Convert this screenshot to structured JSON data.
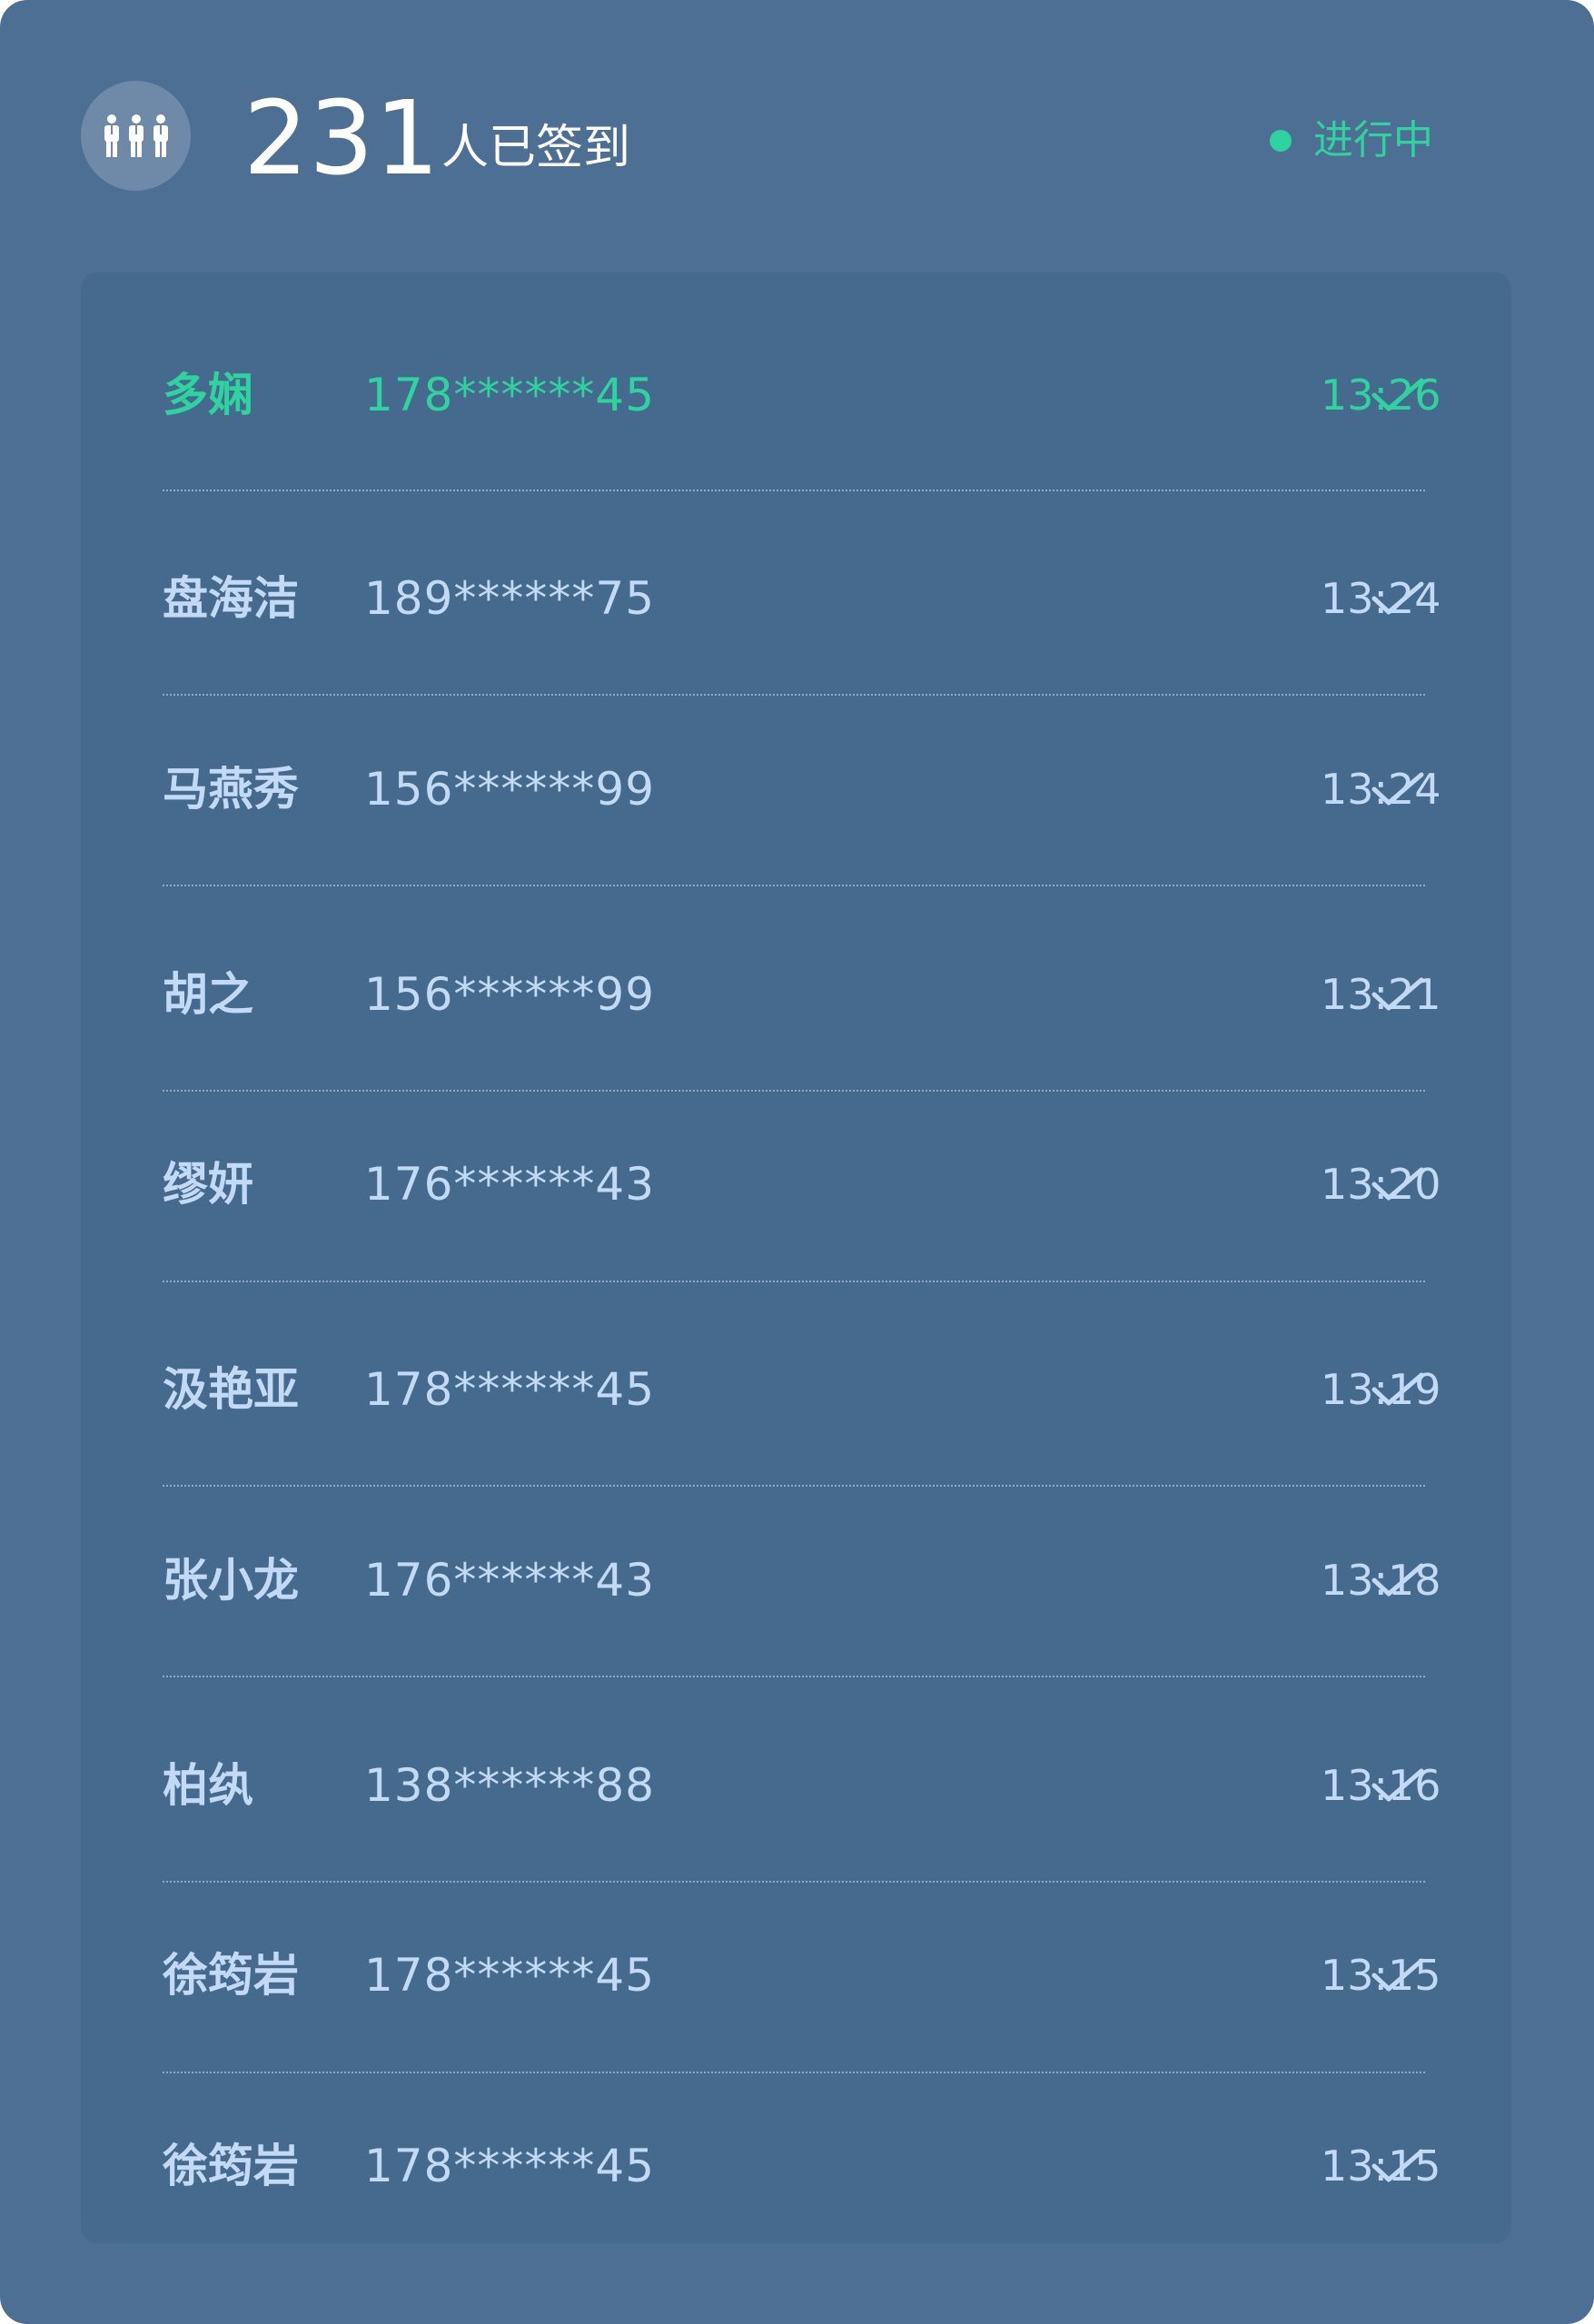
{
  "header": {
    "count": "231",
    "count_label": "人已签到",
    "status": "进行中",
    "icon": "people-group-icon"
  },
  "colors": {
    "panel": "#4e6f94",
    "list": "#466a8d",
    "accent": "#2fd39f",
    "text": "#c2daf5"
  },
  "rows": [
    {
      "name": "多娴",
      "phone": "178******45",
      "time": "13:26",
      "active": true
    },
    {
      "name": "盘海洁",
      "phone": "189******75",
      "time": "13:24",
      "active": false
    },
    {
      "name": "马燕秀",
      "phone": "156******99",
      "time": "13:24",
      "active": false
    },
    {
      "name": "胡之",
      "phone": "156******99",
      "time": "13:21",
      "active": false
    },
    {
      "name": "缪妍",
      "phone": "176******43",
      "time": "13:20",
      "active": false
    },
    {
      "name": "汲艳亚",
      "phone": "178******45",
      "time": "13:19",
      "active": false
    },
    {
      "name": "张小龙",
      "phone": "176******43",
      "time": "13:18",
      "active": false
    },
    {
      "name": "柏纨",
      "phone": "138******88",
      "time": "13:16",
      "active": false
    },
    {
      "name": "徐筠岩",
      "phone": "178******45",
      "time": "13:15",
      "active": false
    },
    {
      "name": "徐筠岩",
      "phone": "178******45",
      "time": "13:15",
      "active": false
    }
  ]
}
